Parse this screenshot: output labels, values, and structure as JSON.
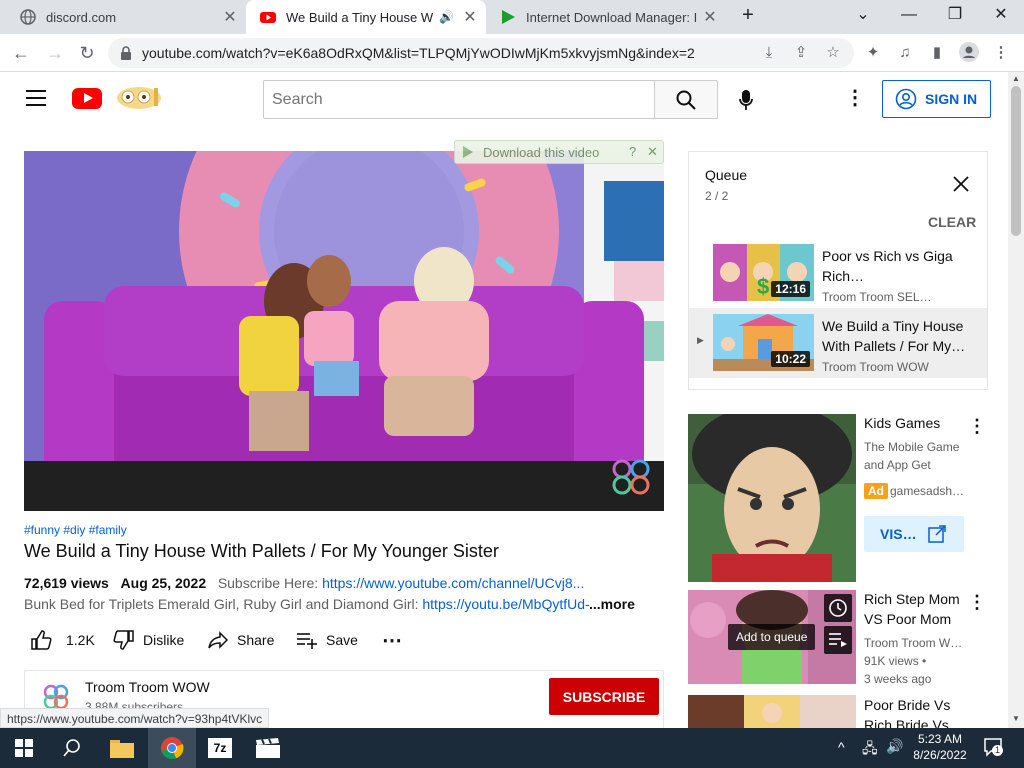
{
  "browser": {
    "tabs": [
      {
        "title": "discord.com"
      },
      {
        "title": "We Build a Tiny House With",
        "active": true
      },
      {
        "title": "Internet Download Manager: I ca"
      }
    ],
    "url": "youtube.com/watch?v=eK6a8OdRxQM&list=TLPQMjYwODIwMjKm5xkvyjsmNg&index=2",
    "status_url": "https://www.youtube.com/watch?v=93hp4tVKlvc"
  },
  "header": {
    "search_placeholder": "Search",
    "sign_in": "SIGN IN"
  },
  "video": {
    "download_bar": "Download this video",
    "download_help": "?",
    "download_close": "✕",
    "hashtags": "#funny #diy #family",
    "title": "We Build a Tiny House With Pallets / For My Younger Sister",
    "views": "72,619 views",
    "date": "Aug 25, 2022",
    "subscribe_here": "Subscribe Here:",
    "channel_link": "https://www.youtube.com/channel/UCvj8...",
    "desc_line2": "Bunk Bed for Triplets Emerald Girl, Ruby Girl and Diamond Girl:",
    "desc_link2": "https://youtu.be/MbQytfUd-",
    "more": "...more",
    "likes": "1.2K",
    "dislike": "Dislike",
    "share": "Share",
    "save": "Save"
  },
  "channel": {
    "name": "Troom Troom WOW",
    "subscribers": "3.88M subscribers",
    "subscribe": "SUBSCRIBE"
  },
  "queue": {
    "title": "Queue",
    "position": "2 / 2",
    "clear": "CLEAR",
    "items": [
      {
        "title": "Poor vs Rich vs Giga Rich…",
        "channel": "Troom Troom SEL…",
        "duration": "12:16"
      },
      {
        "title": "We Build a Tiny House With Pallets / For My…",
        "channel": "Troom Troom WOW",
        "duration": "10:22"
      }
    ]
  },
  "recommendations": [
    {
      "title": "Kids Games",
      "line1": "The Mobile Game",
      "line2": "and App Get",
      "ad_badge": "Ad",
      "advertiser": "gamesadsh…",
      "visit": "VIS…"
    },
    {
      "title": "Rich Step Mom VS Poor Mom",
      "channel": "Troom Troom W…",
      "views": "91K views •",
      "age": "3 weeks ago",
      "hover_label": "Add to queue"
    },
    {
      "title": "Poor Bride Vs Rich Bride Vs"
    }
  ],
  "taskbar": {
    "time": "5:23 AM",
    "date": "8/26/2022",
    "notifications": "1"
  }
}
